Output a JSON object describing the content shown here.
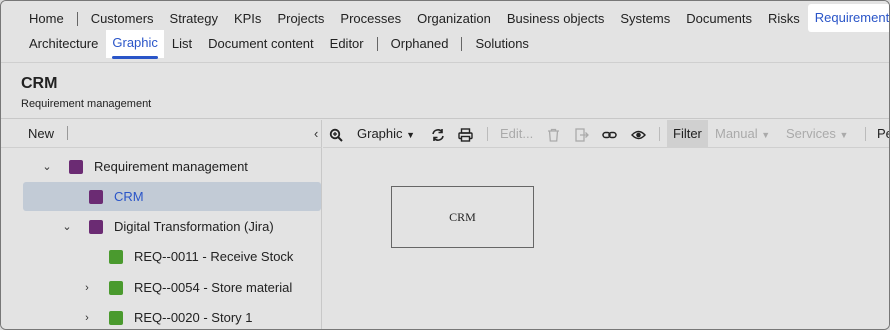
{
  "nav": {
    "row1": [
      "Home",
      "Customers",
      "Strategy",
      "KPIs",
      "Projects",
      "Processes",
      "Organization",
      "Business objects",
      "Systems",
      "Documents",
      "Risks",
      "Requirements"
    ],
    "row2": [
      "Architecture",
      "Graphic",
      "List",
      "Document content",
      "Editor",
      "Orphaned",
      "Solutions"
    ]
  },
  "header": {
    "title": "CRM",
    "subtitle": "Requirement management"
  },
  "left_panel": {
    "new_label": "New",
    "tree": [
      {
        "label": "Requirement management",
        "color": "#6b2b73",
        "expander": "expanded"
      },
      {
        "label": "CRM",
        "color": "#6b2b73",
        "expander": "none",
        "selected": true
      },
      {
        "label": "Digital Transformation (Jira)",
        "color": "#6b2b73",
        "expander": "expanded"
      },
      {
        "label": "REQ--0011 - Receive Stock",
        "color": "#4a9a2e",
        "expander": "none"
      },
      {
        "label": "REQ--0054 - Store material",
        "color": "#4a9a2e",
        "expander": "collapsed"
      },
      {
        "label": "REQ--0020 - Story 1",
        "color": "#4a9a2e",
        "expander": "collapsed"
      }
    ]
  },
  "toolbar": {
    "graphic_label": "Graphic",
    "edit_label": "Edit...",
    "filter_label": "Filter",
    "manual_label": "Manual",
    "services_label": "Services",
    "truncated_label": "Pe"
  },
  "canvas": {
    "node_label": "CRM"
  },
  "colors": {
    "accent": "#2a55c8",
    "purple": "#6b2b73",
    "green": "#4a9a2e"
  }
}
